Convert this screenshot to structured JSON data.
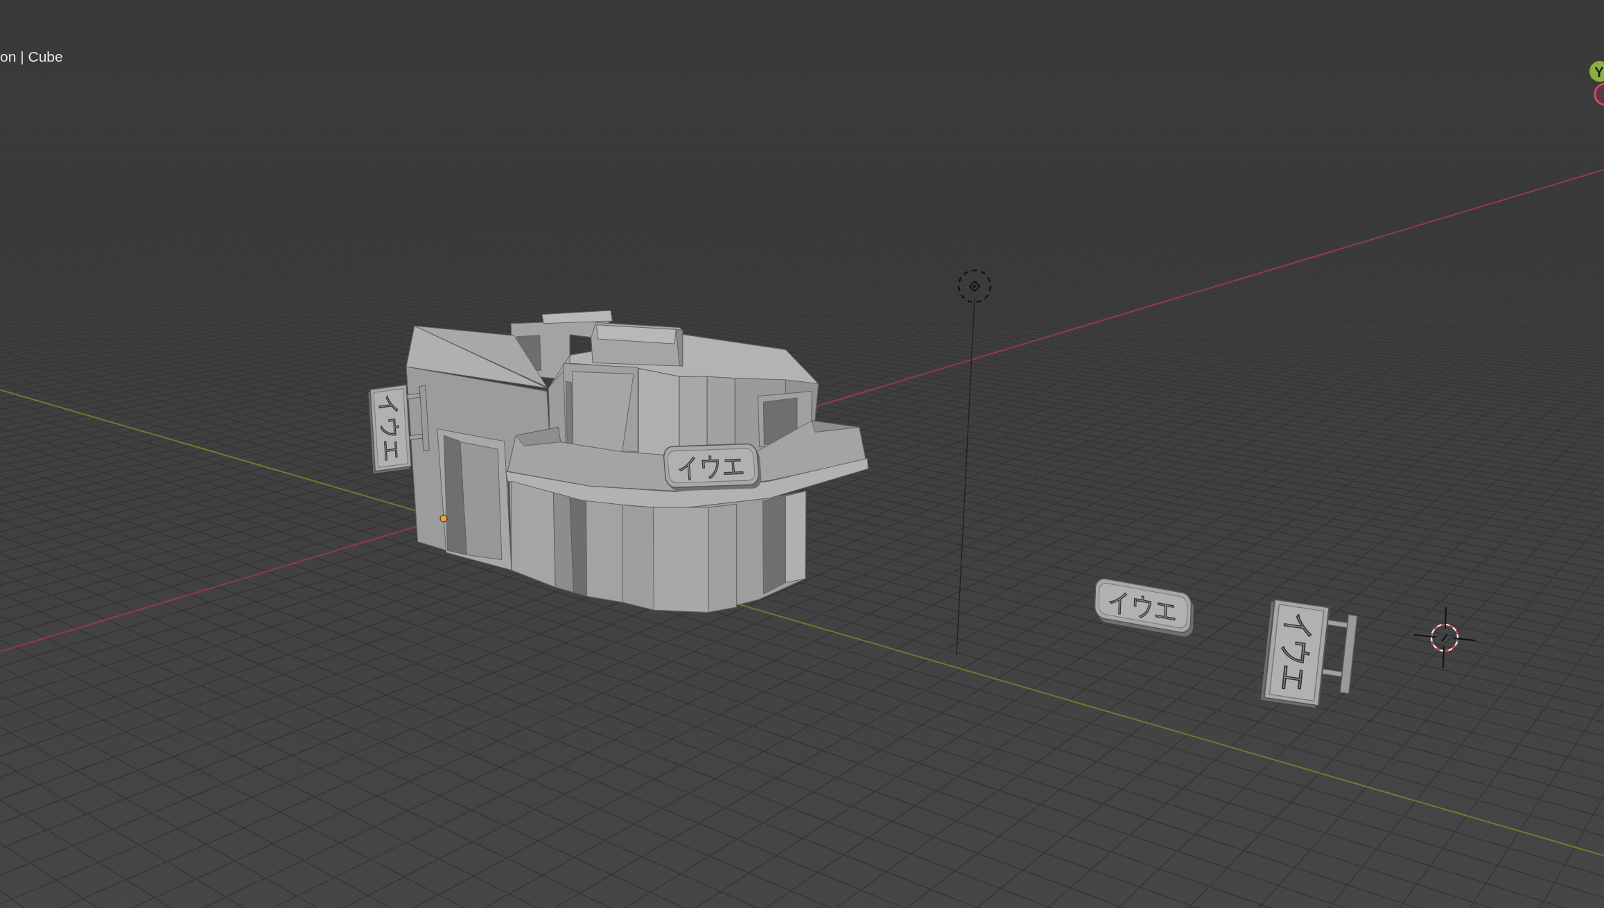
{
  "viewport_header": {
    "text": "on | Cube"
  },
  "navigation_gizmo": {
    "axes": [
      {
        "kind": "negative",
        "color": "#d9465b"
      },
      {
        "kind": "positive",
        "label": "Y",
        "color": "#8aad42"
      }
    ]
  },
  "scene": {
    "building": {
      "signs": [
        {
          "kind": "vertical",
          "text": "イウエ"
        },
        {
          "kind": "horizontal",
          "text": "イウエ"
        }
      ]
    },
    "loose_signs": [
      {
        "kind": "horizontal",
        "text": "イウエ"
      },
      {
        "kind": "vertical",
        "text": "イウエ"
      }
    ]
  }
}
